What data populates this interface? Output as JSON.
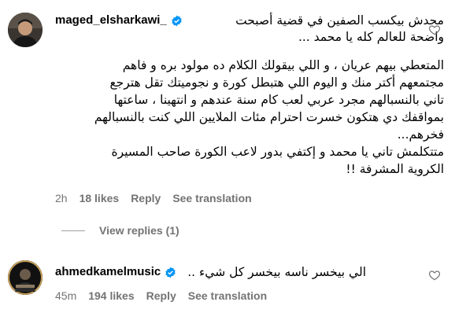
{
  "comments": [
    {
      "username": "maged_elsharkawi_",
      "first_line": "محدش بيكسب الصفين في قضية أصبحت",
      "text_lines": [
        "واضحة للعالم كله يا محمد ...",
        "",
        "المتعطي بيهم عريان ، و اللي بيقولك الكلام ده مولود بره و فاهم",
        "مجتمعهم أكتر منك و اليوم اللي هتبطل كورة و نجوميتك تقل هترجع",
        "تاني بالنسبالهم مجرد عربي لعب كام سنة عندهم و انتهينا ، ساعتها",
        "بمواقفك دي هتكون خسرت احترام مئات الملايين اللي كنت بالنسبالهم",
        "فخرهم...",
        "متتكلمش تاني يا محمد و إكتفي بدور لاعب الكورة صاحب المسيرة",
        "الكروية المشرفة !!"
      ],
      "time": "2h",
      "likes": "18 likes",
      "reply_label": "Reply",
      "translate_label": "See translation",
      "view_replies": "View replies (1)"
    },
    {
      "username": "ahmedkamelmusic",
      "first_line": "الي بيخسر ناسه بيخسر كل شيء ..",
      "time": "45m",
      "likes": "194 likes",
      "reply_label": "Reply",
      "translate_label": "See translation"
    }
  ],
  "colors": {
    "verified": "#0095f6",
    "meta": "#737373"
  },
  "icons": {
    "heart": "heart-icon",
    "verified": "verified-badge-icon"
  }
}
